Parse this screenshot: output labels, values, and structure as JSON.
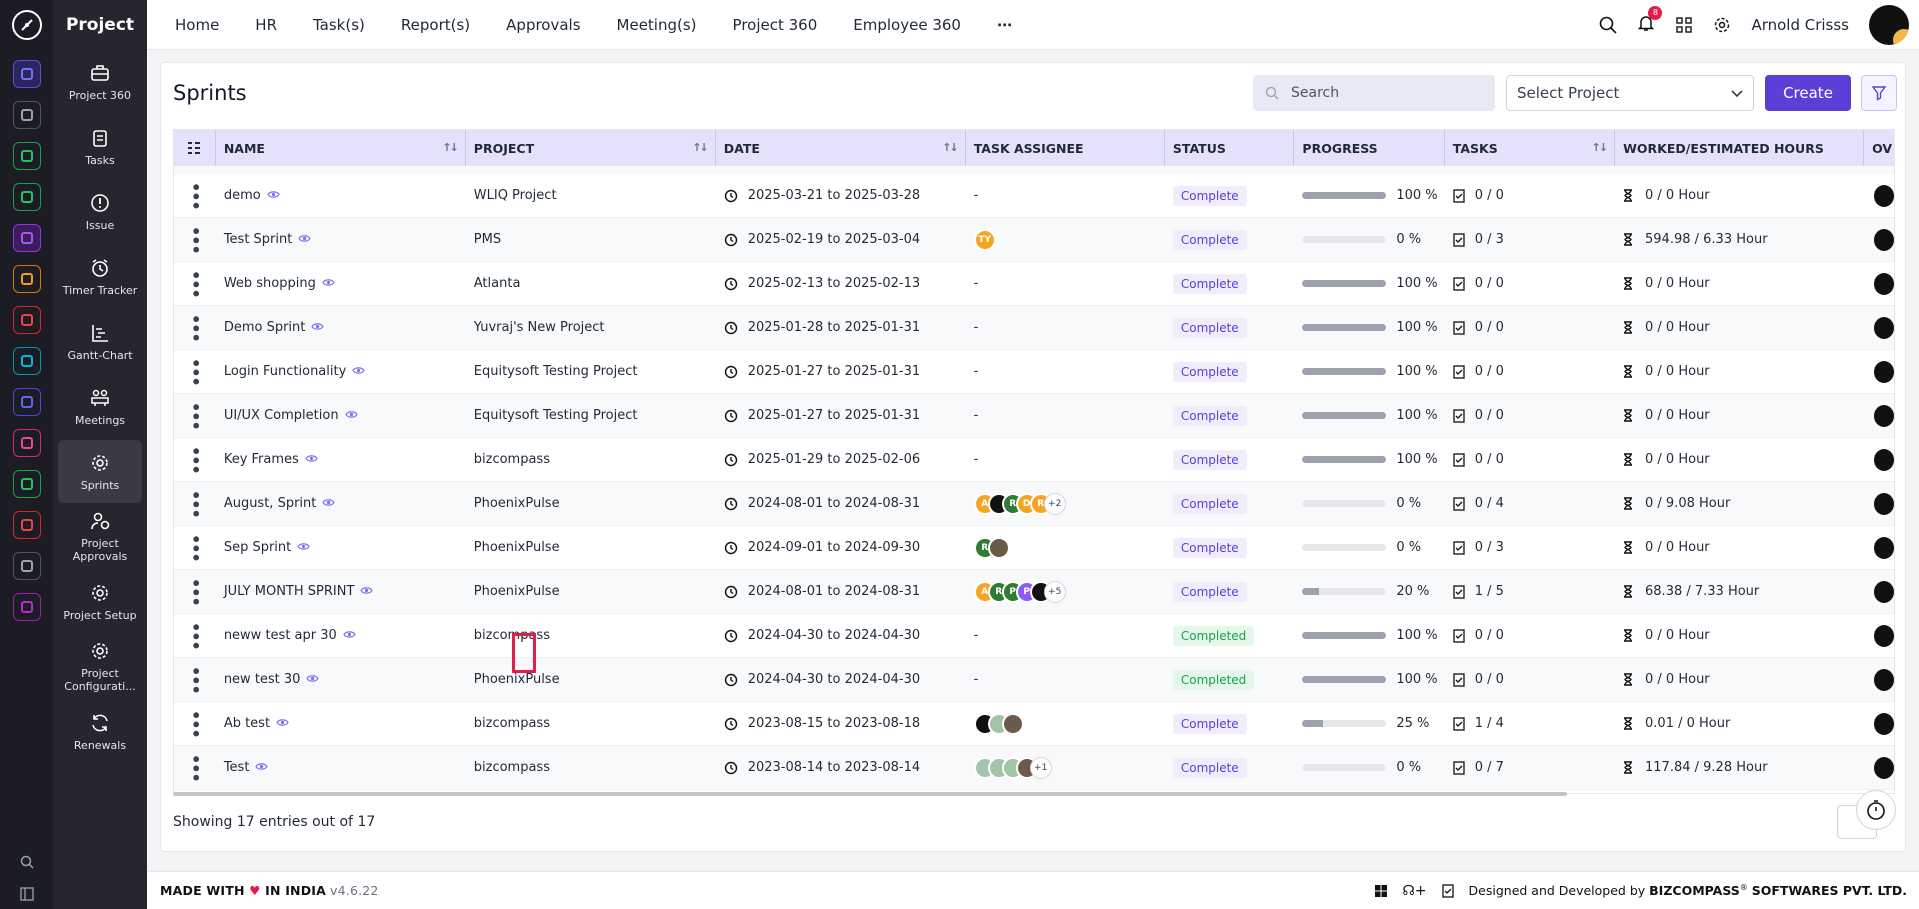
{
  "app": {
    "brand": "Project"
  },
  "topnav": {
    "items": [
      "Home",
      "HR",
      "Task(s)",
      "Report(s)",
      "Approvals",
      "Meeting(s)",
      "Project 360",
      "Employee 360"
    ],
    "notification_count": "8",
    "user_name": "Arnold Crisss"
  },
  "sidebar": {
    "items": [
      {
        "label": "Project 360",
        "icon": "briefcase-icon"
      },
      {
        "label": "Tasks",
        "icon": "clipboard-icon"
      },
      {
        "label": "Issue",
        "icon": "alert-icon"
      },
      {
        "label": "Timer Tracker",
        "icon": "alarm-icon"
      },
      {
        "label": "Gantt-Chart",
        "icon": "gantt-icon"
      },
      {
        "label": "Meetings",
        "icon": "meeting-icon"
      },
      {
        "label": "Sprints",
        "icon": "gear-icon",
        "active": true
      },
      {
        "label": "Project Approvals",
        "icon": "approval-icon"
      },
      {
        "label": "Project Setup",
        "icon": "gear-icon"
      },
      {
        "label": "Project Configurati...",
        "icon": "gear-icon"
      },
      {
        "label": "Renewals",
        "icon": "refresh-icon"
      }
    ]
  },
  "page": {
    "title": "Sprints",
    "search_placeholder": "Search",
    "select_project": "Select Project",
    "create_label": "Create",
    "showing": "Showing 17 entries out of 17"
  },
  "table": {
    "columns": [
      "NAME",
      "PROJECT",
      "DATE",
      "TASK ASSIGNEE",
      "STATUS",
      "PROGRESS",
      "TASKS",
      "WORKED/ESTIMATED HOURS",
      "OV"
    ],
    "rows": [
      {
        "name": "demo",
        "project": "WLIQ Project",
        "date": "2025-03-21 to 2025-03-28",
        "assignee": [],
        "status": "Complete",
        "progress": 100,
        "progress_label": "100 %",
        "tasks": "0 / 0",
        "hours": "0 / 0 Hour"
      },
      {
        "name": "Test Sprint",
        "project": "PMS",
        "date": "2025-02-19 to 2025-03-04",
        "assignee": [
          {
            "t": "TY",
            "c": "#f5a524"
          }
        ],
        "status": "Complete",
        "progress": 0,
        "progress_label": "0 %",
        "tasks": "0 / 3",
        "hours": "594.98 / 6.33 Hour"
      },
      {
        "name": "Web shopping",
        "project": "Atlanta",
        "date": "2025-02-13 to 2025-02-13",
        "assignee": [],
        "status": "Complete",
        "progress": 100,
        "progress_label": "100 %",
        "tasks": "0 / 0",
        "hours": "0 / 0 Hour"
      },
      {
        "name": "Demo Sprint",
        "project": "Yuvraj's New Project",
        "date": "2025-01-28 to 2025-01-31",
        "assignee": [],
        "status": "Complete",
        "progress": 100,
        "progress_label": "100 %",
        "tasks": "0 / 0",
        "hours": "0 / 0 Hour"
      },
      {
        "name": "Login Functionality",
        "project": "Equitysoft Testing Project",
        "date": "2025-01-27 to 2025-01-31",
        "assignee": [],
        "status": "Complete",
        "progress": 100,
        "progress_label": "100 %",
        "tasks": "0 / 0",
        "hours": "0 / 0 Hour"
      },
      {
        "name": "UI/UX Completion",
        "project": "Equitysoft Testing Project",
        "date": "2025-01-27 to 2025-01-31",
        "assignee": [],
        "status": "Complete",
        "progress": 100,
        "progress_label": "100 %",
        "tasks": "0 / 0",
        "hours": "0 / 0 Hour"
      },
      {
        "name": "Key Frames",
        "project": "bizcompass",
        "date": "2025-01-29 to 2025-02-06",
        "assignee": [],
        "status": "Complete",
        "progress": 100,
        "progress_label": "100 %",
        "tasks": "0 / 0",
        "hours": "0 / 0 Hour"
      },
      {
        "name": "August, Sprint",
        "project": "PhoenixPulse",
        "date": "2024-08-01 to 2024-08-31",
        "assignee": [
          {
            "t": "A",
            "c": "#f5a524"
          },
          {
            "t": "",
            "c": "#111111"
          },
          {
            "t": "R",
            "c": "#2e7d32"
          },
          {
            "t": "D",
            "c": "#f5a524"
          },
          {
            "t": "R",
            "c": "#f5a524"
          },
          {
            "t": "+2",
            "c": "more"
          }
        ],
        "status": "Complete",
        "progress": 0,
        "progress_label": "0 %",
        "tasks": "0 / 4",
        "hours": "0 / 9.08 Hour"
      },
      {
        "name": "Sep Sprint",
        "project": "PhoenixPulse",
        "date": "2024-09-01 to 2024-09-30",
        "assignee": [
          {
            "t": "R",
            "c": "#2e7d32"
          },
          {
            "t": "",
            "c": "#6b5a4a"
          }
        ],
        "status": "Complete",
        "progress": 0,
        "progress_label": "0 %",
        "tasks": "0 / 3",
        "hours": "0 / 0 Hour"
      },
      {
        "name": "JULY MONTH SPRINT",
        "project": "PhoenixPulse",
        "date": "2024-08-01 to 2024-08-31",
        "assignee": [
          {
            "t": "A",
            "c": "#f5a524"
          },
          {
            "t": "R",
            "c": "#2e7d32"
          },
          {
            "t": "P",
            "c": "#2e7d32"
          },
          {
            "t": "P",
            "c": "#8b5cf6"
          },
          {
            "t": "",
            "c": "#111111"
          },
          {
            "t": "+5",
            "c": "more"
          }
        ],
        "status": "Complete",
        "progress": 20,
        "progress_label": "20 %",
        "tasks": "1 / 5",
        "hours": "68.38 / 7.33 Hour"
      },
      {
        "name": "neww test apr 30",
        "project": "bizcompass",
        "date": "2024-04-30 to 2024-04-30",
        "assignee": [],
        "status": "Completed",
        "progress": 100,
        "progress_label": "100 %",
        "tasks": "0 / 0",
        "hours": "0 / 0 Hour"
      },
      {
        "name": "new test 30",
        "project": "PhoenixPulse",
        "date": "2024-04-30 to 2024-04-30",
        "assignee": [],
        "status": "Completed",
        "progress": 100,
        "progress_label": "100 %",
        "tasks": "0 / 0",
        "hours": "0 / 0 Hour"
      },
      {
        "name": "Ab test",
        "project": "bizcompass",
        "date": "2023-08-15 to 2023-08-18",
        "assignee": [
          {
            "t": "",
            "c": "#111111"
          },
          {
            "t": "",
            "c": "#a3c4a8"
          },
          {
            "t": "",
            "c": "#6b5a4a"
          }
        ],
        "status": "Complete",
        "progress": 25,
        "progress_label": "25 %",
        "tasks": "1 / 4",
        "hours": "0.01 / 0 Hour"
      },
      {
        "name": "Test",
        "project": "bizcompass",
        "date": "2023-08-14 to 2023-08-14",
        "assignee": [
          {
            "t": "",
            "c": "#a3c4a8"
          },
          {
            "t": "",
            "c": "#a3c4a8"
          },
          {
            "t": "",
            "c": "#a3c4a8"
          },
          {
            "t": "",
            "c": "#6b5a4a"
          },
          {
            "t": "+1",
            "c": "more"
          }
        ],
        "status": "Complete",
        "progress": 0,
        "progress_label": "0 %",
        "tasks": "0 / 7",
        "hours": "117.84 / 9.28 Hour"
      }
    ]
  },
  "footer": {
    "made_with": "MADE WITH",
    "in_india": "IN INDIA",
    "version": "v4.6.22",
    "designed_by": "Designed and Developed by",
    "company": "BIZCOMPASS",
    "company_suffix": "SOFTWARES PVT. LTD."
  },
  "colors": {
    "accent": "#5b3fd6",
    "header_bg": "#e4e2fa",
    "sidebar_bg": "#26262e",
    "rail_bg": "#1c1c24"
  }
}
